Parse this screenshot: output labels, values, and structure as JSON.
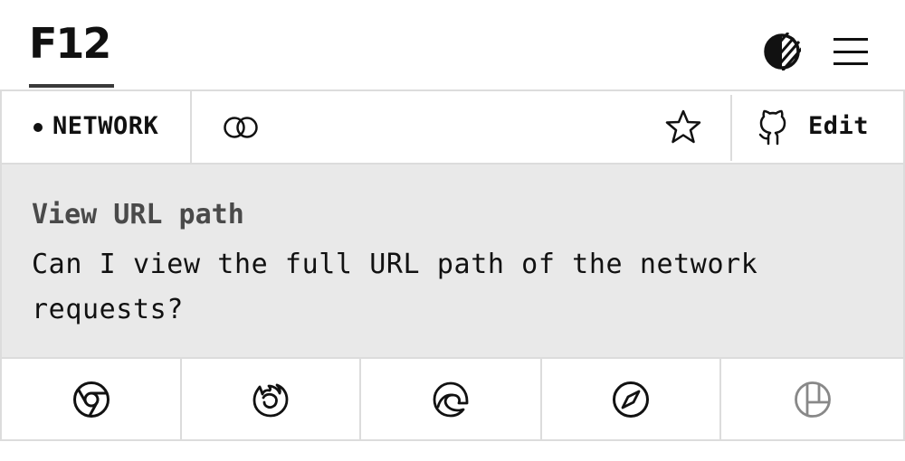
{
  "header": {
    "logo_text": "F12",
    "theme_toggle_icon": "contrast-icon",
    "menu_icon": "hamburger-menu-icon"
  },
  "toolbar": {
    "tag_label": "NETWORK",
    "link_icon": "link-icon",
    "star_icon": "star-icon",
    "edit_label": "Edit",
    "edit_icon": "github-icon"
  },
  "question": {
    "title": "View URL path",
    "text": "Can I view the full URL path of the network requests?"
  },
  "browsers": [
    {
      "name": "chrome",
      "icon": "chrome-icon"
    },
    {
      "name": "firefox",
      "icon": "firefox-icon"
    },
    {
      "name": "edge",
      "icon": "edge-icon"
    },
    {
      "name": "safari",
      "icon": "safari-icon"
    },
    {
      "name": "polypane",
      "icon": "polypane-icon",
      "color": "#888888"
    }
  ]
}
